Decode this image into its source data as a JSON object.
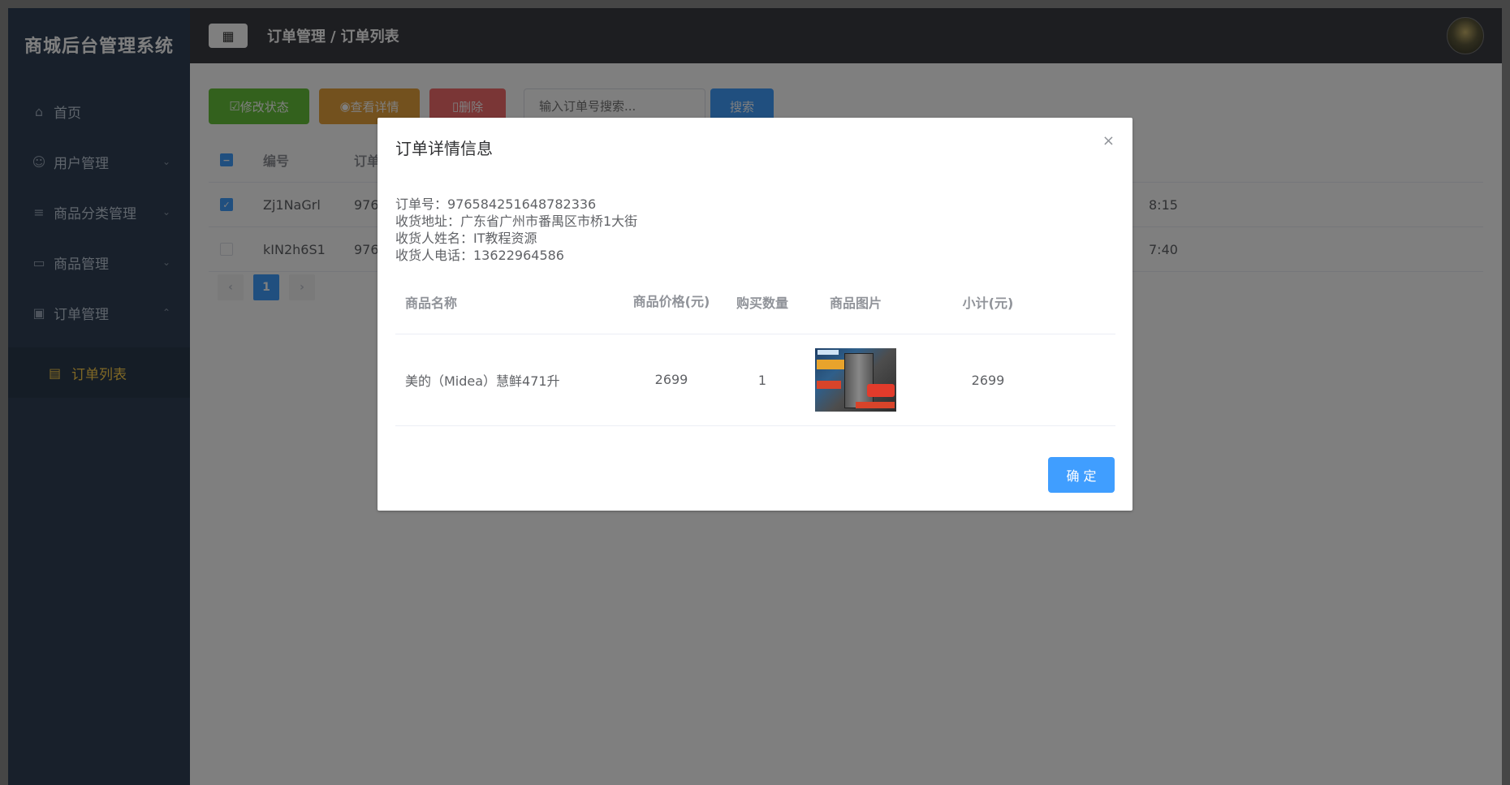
{
  "sidebar": {
    "brand": "商城后台管理系统",
    "items": [
      {
        "label": "首页",
        "icon": "home-icon",
        "has_children": false
      },
      {
        "label": "用户管理",
        "icon": "user-icon",
        "has_children": true
      },
      {
        "label": "商品分类管理",
        "icon": "sliders-icon",
        "has_children": true
      },
      {
        "label": "商品管理",
        "icon": "bag-icon",
        "has_children": true
      },
      {
        "label": "订单管理",
        "icon": "monitor-icon",
        "has_children": true,
        "expanded": true
      }
    ],
    "subitems": [
      {
        "label": "订单列表",
        "icon": "document-icon",
        "active": true
      }
    ]
  },
  "header": {
    "breadcrumb": [
      "订单管理",
      "订单列表"
    ],
    "breadcrumb_sep": "/"
  },
  "toolbar": {
    "edit_status_label": "修改状态",
    "view_detail_label": "查看详情",
    "delete_label": "删除",
    "search_placeholder": "输入订单号搜索...",
    "search_label": "搜索"
  },
  "table": {
    "headers": {
      "code": "编号",
      "order_no": "订单"
    },
    "rows": [
      {
        "checked": true,
        "code": "Zj1NaGrl",
        "order_no": "976",
        "time": "8:15"
      },
      {
        "checked": false,
        "code": "kIN2h6S1",
        "order_no": "976",
        "time": "7:40"
      }
    ]
  },
  "pagination": {
    "prev": "‹",
    "current": "1",
    "next": "›"
  },
  "dialog": {
    "title": "订单详情信息",
    "close": "×",
    "info": {
      "order_no": "订单号：976584251648782336",
      "address": "收货地址：广东省广州市番禺区市桥1大街",
      "name": "收货人姓名：IT教程资源",
      "phone": "收货人电话：13622964586"
    },
    "columns": {
      "name": "商品名称",
      "price": "商品价格(元)",
      "qty": "购买数量",
      "image": "商品图片",
      "subtotal": "小计(元)"
    },
    "items": [
      {
        "name": "美的（Midea）慧鲜471升",
        "price": "2699",
        "qty": "1",
        "subtotal": "2699"
      }
    ],
    "confirm": "确 定"
  },
  "colors": {
    "sidebar_bg": "#304156",
    "header_bg": "#3a3d42",
    "active_menu": "#ffd04b",
    "primary": "#409eff",
    "success": "#67c23a",
    "warning": "#e6a23c",
    "danger": "#f56c6c"
  }
}
